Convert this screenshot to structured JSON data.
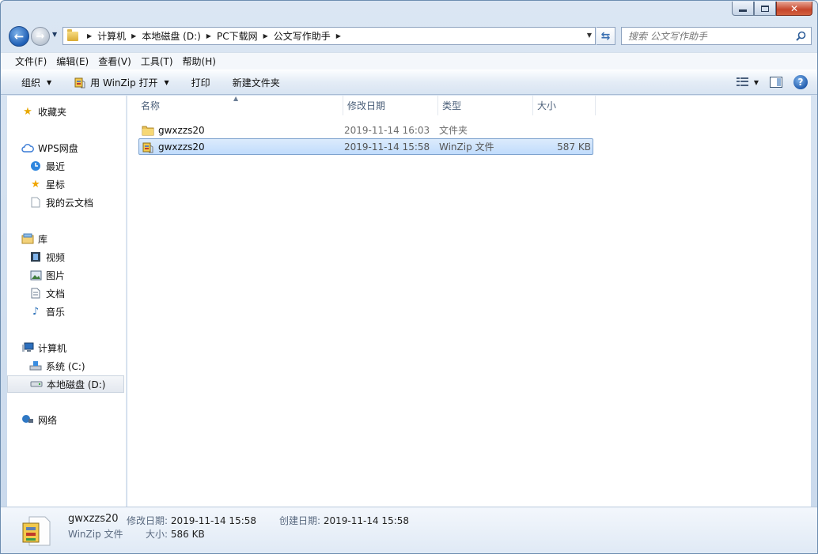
{
  "window": {
    "controls": {
      "minimize": "minimize",
      "maximize": "maximize",
      "close": "close"
    }
  },
  "address": {
    "crumbs": [
      "计算机",
      "本地磁盘 (D:)",
      "PC下载网",
      "公文写作助手"
    ]
  },
  "search": {
    "placeholder": "搜索 公文写作助手"
  },
  "menu": {
    "items": [
      "文件(F)",
      "编辑(E)",
      "查看(V)",
      "工具(T)",
      "帮助(H)"
    ]
  },
  "toolbar": {
    "organize": "组织",
    "open_with": "用 WinZip 打开",
    "print": "打印",
    "new_folder": "新建文件夹"
  },
  "nav": {
    "favorites": "收藏夹",
    "wps": "WPS网盘",
    "wps_items": [
      "最近",
      "星标",
      "我的云文档"
    ],
    "libraries": "库",
    "library_items": [
      "视频",
      "图片",
      "文档",
      "音乐"
    ],
    "computer": "计算机",
    "drives": [
      "系统 (C:)",
      "本地磁盘 (D:)"
    ],
    "network": "网络"
  },
  "columns": {
    "name": "名称",
    "date": "修改日期",
    "type": "类型",
    "size": "大小"
  },
  "files": [
    {
      "name": "gwxzzs20",
      "date": "2019-11-14 16:03",
      "type": "文件夹",
      "size": "",
      "icon": "folder-icon",
      "selected": false
    },
    {
      "name": "gwxzzs20",
      "date": "2019-11-14 15:58",
      "type": "WinZip 文件",
      "size": "587 KB",
      "icon": "winzip-icon",
      "selected": true
    }
  ],
  "details": {
    "name": "gwxzzs20",
    "type": "WinZip 文件",
    "modified_label": "修改日期:",
    "modified_value": "2019-11-14 15:58",
    "created_label": "创建日期:",
    "created_value": "2019-11-14 15:58",
    "size_label": "大小:",
    "size_value": "586 KB"
  },
  "colors": {
    "selection": "#c1dcfc",
    "accent": "#1e5eb5"
  }
}
